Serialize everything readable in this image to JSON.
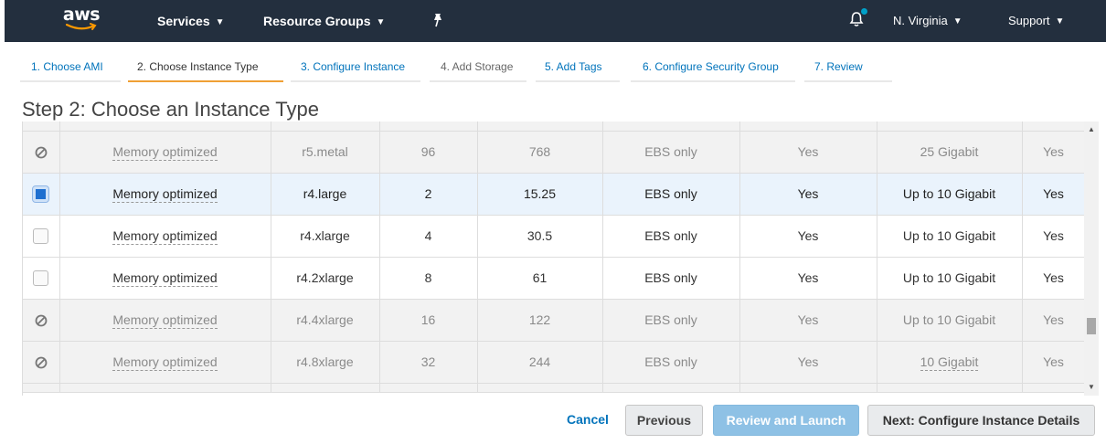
{
  "nav": {
    "logo_text": "aws",
    "services": "Services",
    "resource_groups": "Resource Groups",
    "region": "N. Virginia",
    "support": "Support",
    "caret": "⌄"
  },
  "steps": [
    {
      "label": "1. Choose AMI"
    },
    {
      "label": "2. Choose Instance Type"
    },
    {
      "label": "3. Configure Instance"
    },
    {
      "label": "4. Add Storage"
    },
    {
      "label": "5. Add Tags"
    },
    {
      "label": "6. Configure Security Group"
    },
    {
      "label": "7. Review"
    }
  ],
  "page_title": "Step 2: Choose an Instance Type",
  "rows": [
    {
      "state": "disabled",
      "family": "Memory optimized",
      "type": "r5.metal",
      "vcpus": "96",
      "memory": "768",
      "storage": "EBS only",
      "ebs": "Yes",
      "network": "25 Gigabit",
      "ipv6": "Yes"
    },
    {
      "state": "selected",
      "family": "Memory optimized",
      "type": "r4.large",
      "vcpus": "2",
      "memory": "15.25",
      "storage": "EBS only",
      "ebs": "Yes",
      "network": "Up to 10 Gigabit",
      "ipv6": "Yes"
    },
    {
      "state": "normal",
      "family": "Memory optimized",
      "type": "r4.xlarge",
      "vcpus": "4",
      "memory": "30.5",
      "storage": "EBS only",
      "ebs": "Yes",
      "network": "Up to 10 Gigabit",
      "ipv6": "Yes"
    },
    {
      "state": "normal",
      "family": "Memory optimized",
      "type": "r4.2xlarge",
      "vcpus": "8",
      "memory": "61",
      "storage": "EBS only",
      "ebs": "Yes",
      "network": "Up to 10 Gigabit",
      "ipv6": "Yes"
    },
    {
      "state": "disabled",
      "family": "Memory optimized",
      "type": "r4.4xlarge",
      "vcpus": "16",
      "memory": "122",
      "storage": "EBS only",
      "ebs": "Yes",
      "network": "Up to 10 Gigabit",
      "ipv6": "Yes"
    },
    {
      "state": "disabled",
      "family": "Memory optimized",
      "type": "r4.8xlarge",
      "vcpus": "32",
      "memory": "244",
      "storage": "EBS only",
      "ebs": "Yes",
      "network": "10 Gigabit",
      "ipv6": "Yes"
    }
  ],
  "buttons": {
    "cancel": "Cancel",
    "previous": "Previous",
    "review_launch": "Review and Launch",
    "next": "Next: Configure Instance Details"
  },
  "colors": {
    "nav_bg": "#232f3e",
    "active_step_underline": "#f0a035",
    "link_blue": "#0073bb",
    "selected_row": "#eaf3fc",
    "disabled_row": "#f2f2f2",
    "primary_button_disabled": "#8ec1e5"
  },
  "icons": {
    "notification": "bell-icon",
    "pin": "pin-icon",
    "unavailable": "no-entry-icon",
    "scroll_up": "arrow-up-icon",
    "scroll_down": "arrow-down-icon"
  }
}
